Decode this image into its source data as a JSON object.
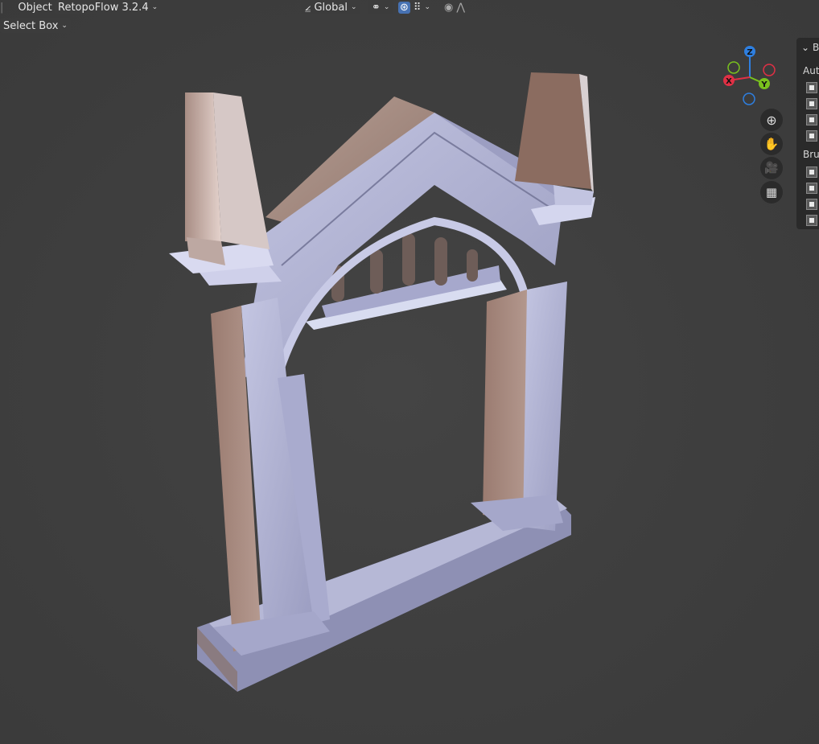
{
  "header": {
    "object_menu": "Object",
    "addon_menu": "RetopoFlow 3.2.4",
    "transform_orientation": "Global",
    "select_mode": "Select Box"
  },
  "side_panel": {
    "header_letter": "B",
    "section1": "Aut",
    "section2": "Bru"
  },
  "gizmo": {
    "x": "X",
    "y": "Y",
    "z": "Z"
  },
  "colors": {
    "x_axis": "#e03045",
    "y_axis": "#7ac21e",
    "z_axis": "#2e7fe0"
  }
}
